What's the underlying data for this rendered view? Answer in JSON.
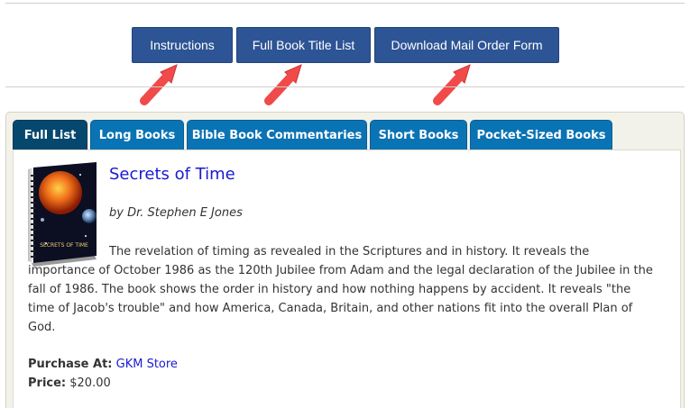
{
  "top_buttons": {
    "instructions": "Instructions",
    "full_title_list": "Full Book Title List",
    "mail_order_form": "Download Mail Order Form"
  },
  "tabs": [
    {
      "label": "Full List",
      "active": true
    },
    {
      "label": "Long Books",
      "active": false
    },
    {
      "label": "Bible Book Commentaries",
      "active": false
    },
    {
      "label": "Short Books",
      "active": false
    },
    {
      "label": "Pocket-Sized Books",
      "active": false
    }
  ],
  "book": {
    "title": "Secrets of Time",
    "author": "by Dr. Stephen E Jones",
    "description": "The revelation of timing as revealed in the Scriptures and in history. It reveals the importance of October 1986 as the 120th Jubilee from Adam and the legal declaration of the Jubilee in the fall of 1986. The book shows the order in history and how nothing happens by accident. It reveals \"the time of Jacob's trouble\" and how America, Canada, Britain, and other nations fit into the overall Plan of God.",
    "purchase_label": "Purchase At:",
    "purchase_link": "GKM Store",
    "price_label": "Price:",
    "price_value": "$20.00",
    "cover_text": "SECRETS OF TIME"
  },
  "colors": {
    "button_blue": "#2d5494",
    "tab_blue": "#0a73b4",
    "tab_active": "#06476e",
    "arrow_red": "#f04a4a",
    "link_blue": "#1a1ad2"
  }
}
